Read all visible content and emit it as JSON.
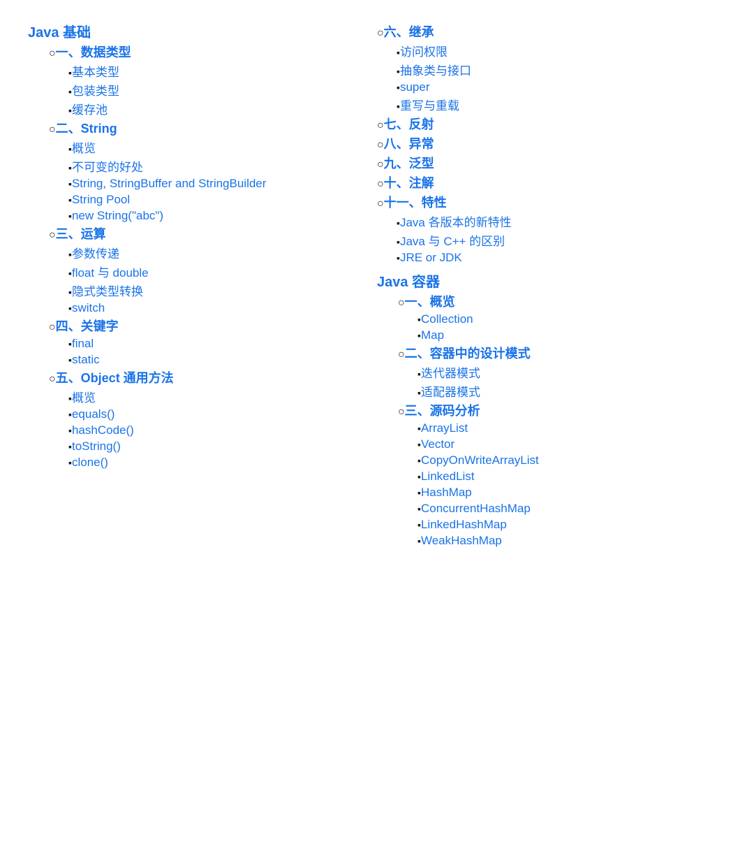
{
  "leftCol": {
    "sections": [
      {
        "id": "java-basics",
        "label": "Java 基础",
        "children": [
          {
            "id": "data-types",
            "label": "一、数据类型",
            "children": [
              {
                "id": "basic-types",
                "label": "基本类型"
              },
              {
                "id": "wrapper-types",
                "label": "包装类型"
              },
              {
                "id": "cache-pool",
                "label": "缓存池"
              }
            ]
          },
          {
            "id": "string",
            "label": "二、String",
            "children": [
              {
                "id": "overview",
                "label": "概览"
              },
              {
                "id": "immutable-benefits",
                "label": "不可变的好处"
              },
              {
                "id": "string-buffer-builder",
                "label": "String, StringBuffer and StringBuilder"
              },
              {
                "id": "string-pool",
                "label": "String Pool"
              },
              {
                "id": "new-string",
                "label": "new String(\"abc\")"
              }
            ]
          },
          {
            "id": "operations",
            "label": "三、运算",
            "children": [
              {
                "id": "param-passing",
                "label": "参数传递"
              },
              {
                "id": "float-double",
                "label": "float 与 double"
              },
              {
                "id": "implicit-cast",
                "label": "隐式类型转换"
              },
              {
                "id": "switch",
                "label": "switch"
              }
            ]
          },
          {
            "id": "keywords",
            "label": "四、关键字",
            "children": [
              {
                "id": "final",
                "label": "final"
              },
              {
                "id": "static",
                "label": "static"
              }
            ]
          },
          {
            "id": "object-methods",
            "label": "五、Object 通用方法",
            "children": [
              {
                "id": "overview2",
                "label": "概览"
              },
              {
                "id": "equals",
                "label": "equals()"
              },
              {
                "id": "hashcode",
                "label": "hashCode()"
              },
              {
                "id": "tostring",
                "label": "toString()"
              },
              {
                "id": "clone",
                "label": "clone()"
              }
            ]
          }
        ]
      }
    ]
  },
  "rightCol": {
    "sections": [
      {
        "id": "java-basics-continued",
        "label": null,
        "subsections": [
          {
            "id": "inheritance",
            "label": "六、继承",
            "children": [
              {
                "id": "access-control",
                "label": "访问权限"
              },
              {
                "id": "abstract-interface",
                "label": "抽象类与接口"
              },
              {
                "id": "super",
                "label": "super"
              },
              {
                "id": "override-overload",
                "label": "重写与重载"
              }
            ]
          },
          {
            "id": "reflection",
            "label": "七、反射",
            "children": []
          },
          {
            "id": "exception",
            "label": "八、异常",
            "children": []
          },
          {
            "id": "generics",
            "label": "九、泛型",
            "children": []
          },
          {
            "id": "annotation",
            "label": "十、注解",
            "children": []
          },
          {
            "id": "features",
            "label": "十一、特性",
            "children": [
              {
                "id": "java-versions",
                "label": "Java 各版本的新特性"
              },
              {
                "id": "java-vs-cpp",
                "label": "Java 与 C++ 的区别"
              },
              {
                "id": "jre-jdk",
                "label": "JRE or JDK"
              }
            ]
          }
        ]
      },
      {
        "id": "java-container",
        "label": "Java 容器",
        "subsections": [
          {
            "id": "container-overview",
            "label": "一、概览",
            "children": [
              {
                "id": "collection",
                "label": "Collection"
              },
              {
                "id": "map",
                "label": "Map"
              }
            ]
          },
          {
            "id": "container-design-patterns",
            "label": "二、容器中的设计模式",
            "children": [
              {
                "id": "iterator-pattern",
                "label": "迭代器模式"
              },
              {
                "id": "adapter-pattern",
                "label": "适配器模式"
              }
            ]
          },
          {
            "id": "source-analysis",
            "label": "三、源码分析",
            "children": [
              {
                "id": "arraylist",
                "label": "ArrayList"
              },
              {
                "id": "vector",
                "label": "Vector"
              },
              {
                "id": "copyonwrite",
                "label": "CopyOnWriteArrayList"
              },
              {
                "id": "linkedlist",
                "label": "LinkedList"
              },
              {
                "id": "hashmap",
                "label": "HashMap"
              },
              {
                "id": "concurrenthashmap",
                "label": "ConcurrentHashMap"
              },
              {
                "id": "linkedhashmap",
                "label": "LinkedHashMap"
              },
              {
                "id": "weakhashmap",
                "label": "WeakHashMap"
              }
            ]
          }
        ]
      }
    ]
  }
}
